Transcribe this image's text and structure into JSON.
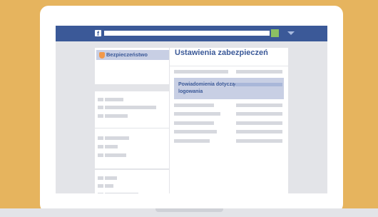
{
  "colors": {
    "background": "#e6b45e",
    "topbar": "#3b5998",
    "accent_text": "#3b5998",
    "selected_bg": "#c8cfe4",
    "avatar": "#8cc063",
    "shield": "#f2994a"
  },
  "topbar": {
    "logo": "f",
    "search_placeholder": "",
    "icons": {
      "avatar": "avatar",
      "menu": "chevron-down-icon"
    }
  },
  "sidebar": {
    "selected_item": {
      "label": "Bezpieczeństwo",
      "icon": "shield-icon"
    }
  },
  "main": {
    "title": "Ustawienia zabezpieczeń",
    "highlighted_row": {
      "label": "Powiadomienia dotyczące logowania"
    }
  }
}
